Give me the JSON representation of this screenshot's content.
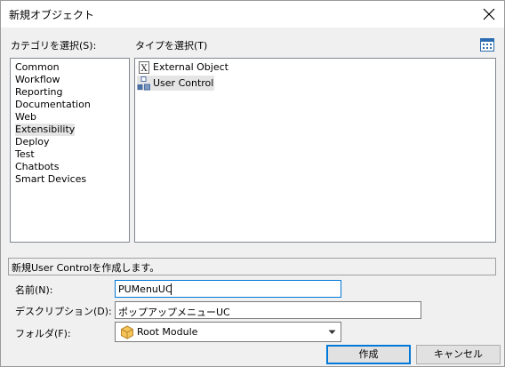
{
  "dialog": {
    "title": "新規オブジェクト",
    "category_label": "カテゴリを選択(S):",
    "type_label": "タイプを選択(T)",
    "categories": [
      "Common",
      "Workflow",
      "Reporting",
      "Documentation",
      "Web",
      "Extensibility",
      "Deploy",
      "Test",
      "Chatbots",
      "Smart Devices"
    ],
    "selected_category": "Extensibility",
    "types": [
      {
        "label": "External Object",
        "icon": "external-object-icon"
      },
      {
        "label": "User Control",
        "icon": "user-control-icon"
      }
    ],
    "selected_type": "User Control",
    "status_text": "新規User Controlを作成します。",
    "name_label": "名前(N):",
    "name_value": "PUMenuUC",
    "description_label": "デスクリプション(D):",
    "description_value": "ポップアップメニューUC",
    "folder_label": "フォルダ(F):",
    "folder_value": "Root Module",
    "create_button": "作成",
    "cancel_button": "キャンセル"
  },
  "colors": {
    "accent": "#0078d7",
    "background": "#f0f0f0",
    "selection": "#e5e5e5"
  }
}
